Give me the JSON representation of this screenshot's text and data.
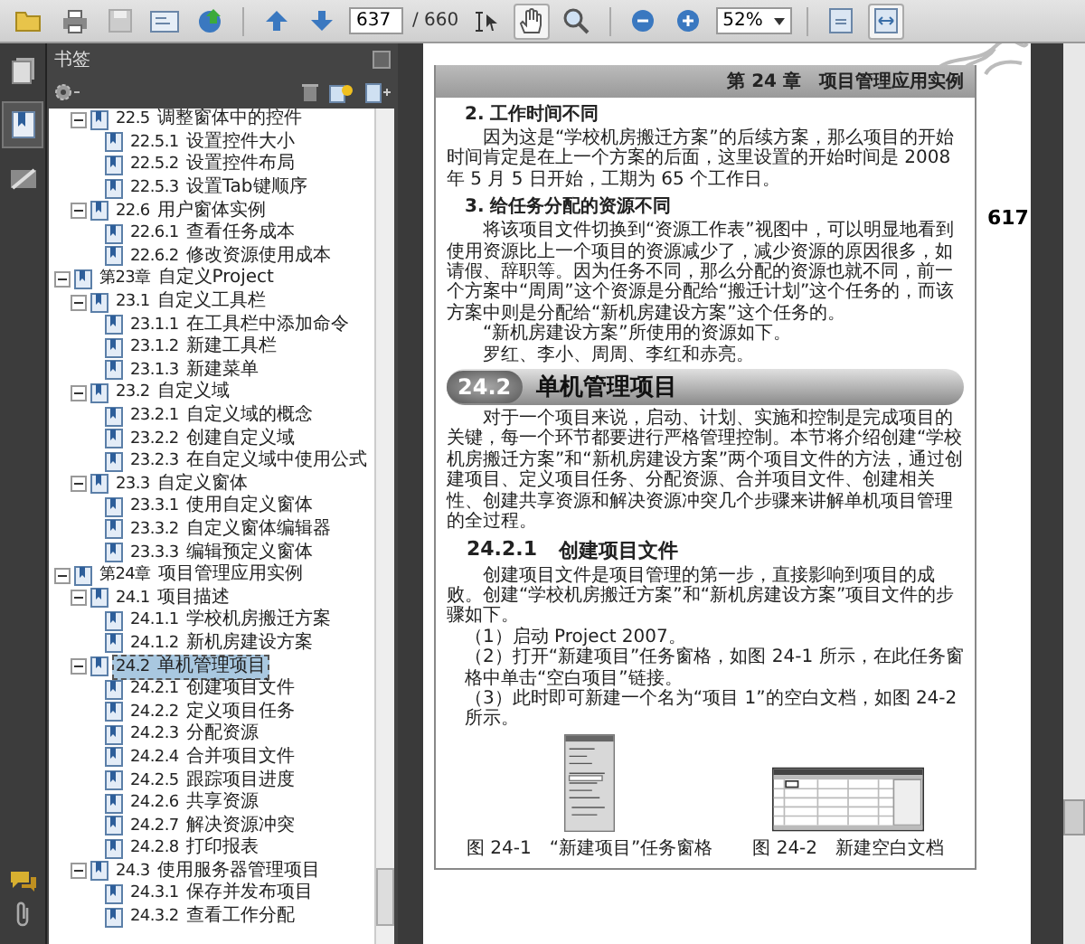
{
  "toolbar": {
    "page_number": "637",
    "page_count": "/ 660",
    "zoom": "52%",
    "tools": [
      {
        "kind": "select-text",
        "selected": false
      },
      {
        "kind": "hand",
        "selected": true
      }
    ],
    "view_buttons": [
      {
        "kind": "fit-page",
        "selected": false
      },
      {
        "kind": "fit-width",
        "selected": true
      }
    ]
  },
  "rail": [
    {
      "kind": "pages",
      "selected": false
    },
    {
      "kind": "bookmarks",
      "selected": true
    },
    {
      "kind": "signatures",
      "selected": false
    }
  ],
  "bookmarks_panel": {
    "title": "书签",
    "items": [
      {
        "kind": "section",
        "number": "22.5",
        "title": "调整窗体中的控件",
        "selected": false,
        "expanded": true,
        "children": [
          {
            "number": "22.5.1",
            "title": "设置控件大小",
            "selected": false
          },
          {
            "number": "22.5.2",
            "title": "设置控件布局",
            "selected": false
          },
          {
            "number": "22.5.3",
            "title": "设置Tab键顺序",
            "selected": false
          }
        ]
      },
      {
        "kind": "section",
        "number": "22.6",
        "title": "用户窗体实例",
        "selected": false,
        "expanded": true,
        "children": [
          {
            "number": "22.6.1",
            "title": "查看任务成本",
            "selected": false
          },
          {
            "number": "22.6.2",
            "title": "修改资源使用成本",
            "selected": false
          }
        ]
      },
      {
        "kind": "chapter",
        "number": "第23章",
        "title": "自定义Project",
        "selected": false,
        "expanded": true,
        "children": [
          {
            "number": "23.1",
            "title": "自定义工具栏",
            "selected": false,
            "expanded": true,
            "children": [
              {
                "number": "23.1.1",
                "title": "在工具栏中添加命令",
                "selected": false
              },
              {
                "number": "23.1.2",
                "title": "新建工具栏",
                "selected": false
              },
              {
                "number": "23.1.3",
                "title": "新建菜单",
                "selected": false
              }
            ]
          },
          {
            "number": "23.2",
            "title": "自定义域",
            "selected": false,
            "expanded": true,
            "children": [
              {
                "number": "23.2.1",
                "title": "自定义域的概念",
                "selected": false
              },
              {
                "number": "23.2.2",
                "title": "创建自定义域",
                "selected": false
              },
              {
                "number": "23.2.3",
                "title": "在自定义域中使用公式",
                "selected": false
              }
            ]
          },
          {
            "number": "23.3",
            "title": "自定义窗体",
            "selected": false,
            "expanded": true,
            "children": [
              {
                "number": "23.3.1",
                "title": "使用自定义窗体",
                "selected": false
              },
              {
                "number": "23.3.2",
                "title": "自定义窗体编辑器",
                "selected": false
              },
              {
                "number": "23.3.3",
                "title": "编辑预定义窗体",
                "selected": false
              }
            ]
          }
        ]
      },
      {
        "kind": "chapter",
        "number": "第24章",
        "title": "项目管理应用实例",
        "selected": false,
        "expanded": true,
        "children": [
          {
            "number": "24.1",
            "title": "项目描述",
            "selected": false,
            "expanded": true,
            "children": [
              {
                "number": "24.1.1",
                "title": "学校机房搬迁方案",
                "selected": false
              },
              {
                "number": "24.1.2",
                "title": "新机房建设方案",
                "selected": false
              }
            ]
          },
          {
            "number": "24.2",
            "title": "单机管理项目",
            "selected": true,
            "expanded": true,
            "children": [
              {
                "number": "24.2.1",
                "title": "创建项目文件",
                "selected": false
              },
              {
                "number": "24.2.2",
                "title": "定义项目任务",
                "selected": false
              },
              {
                "number": "24.2.3",
                "title": "分配资源",
                "selected": false
              },
              {
                "number": "24.2.4",
                "title": "合并项目文件",
                "selected": false
              },
              {
                "number": "24.2.5",
                "title": "跟踪项目进度",
                "selected": false
              },
              {
                "number": "24.2.6",
                "title": "共享资源",
                "selected": false
              },
              {
                "number": "24.2.7",
                "title": "解决资源冲突",
                "selected": false
              },
              {
                "number": "24.2.8",
                "title": "打印报表",
                "selected": false
              }
            ]
          },
          {
            "number": "24.3",
            "title": "使用服务器管理项目",
            "selected": false,
            "expanded": true,
            "children": [
              {
                "number": "24.3.1",
                "title": "保存并发布项目",
                "selected": false
              },
              {
                "number": "24.3.2",
                "title": "查看工作分配",
                "selected": false
              }
            ]
          }
        ]
      }
    ]
  },
  "page": {
    "running_header": "第 24 章　项目管理应用实例",
    "page_number": "617",
    "blocks": [
      {
        "kind": "subheading",
        "text": "2. 工作时间不同"
      },
      {
        "kind": "paragraph",
        "text": "因为这是“学校机房搬迁方案”的后续方案，那么项目的开始时间肯定是在上一个方案的后面，这里设置的开始时间是 2008 年 5 月 5 日开始，工期为 65 个工作日。"
      },
      {
        "kind": "subheading",
        "text": "3. 给任务分配的资源不同"
      },
      {
        "kind": "paragraph",
        "text": "将该项目文件切换到“资源工作表”视图中，可以明显地看到使用资源比上一个项目的资源减少了，减少资源的原因很多，如请假、辞职等。因为任务不同，那么分配的资源也就不同，前一个方案中“周周”这个资源是分配给“搬迁计划”这个任务的，而该方案中则是分配给“新机房建设方案”这个任务的。"
      },
      {
        "kind": "paragraph",
        "text": "“新机房建设方案”所使用的资源如下。"
      },
      {
        "kind": "paragraph",
        "text": "罗红、李小、周周、李红和赤亮。"
      },
      {
        "kind": "banner",
        "number": "24.2",
        "text": "单机管理项目"
      },
      {
        "kind": "paragraph",
        "text": "对于一个项目来说，启动、计划、实施和控制是完成项目的关键，每一个环节都要进行严格管理控制。本节将介绍创建“学校机房搬迁方案”和“新机房建设方案”两个项目文件的方法，通过创建项目、定义项目任务、分配资源、合并项目文件、创建相关性、创建共享资源和解决资源冲突几个步骤来讲解单机项目管理的全过程。"
      },
      {
        "kind": "heading",
        "number": "24.2.1",
        "text": "创建项目文件"
      },
      {
        "kind": "paragraph",
        "text": "创建项目文件是项目管理的第一步，直接影响到项目的成败。创建“学校机房搬迁方案”和“新机房建设方案”项目文件的步骤如下。"
      },
      {
        "kind": "step",
        "text": "（1）启动 Project 2007。"
      },
      {
        "kind": "step",
        "text": "（2）打开“新建项目”任务窗格，如图 24-1 所示，在此任务窗格中单击“空白项目”链接。"
      },
      {
        "kind": "step",
        "text": "（3）此时即可新建一个名为“项目 1”的空白文档，如图 24-2 所示。"
      },
      {
        "kind": "figures",
        "figures": [
          {
            "kind": "task-pane",
            "caption": "图 24-1　“新建项目”任务窗格"
          },
          {
            "kind": "blank-document",
            "caption": "图 24-2　新建空白文档"
          }
        ]
      }
    ]
  }
}
